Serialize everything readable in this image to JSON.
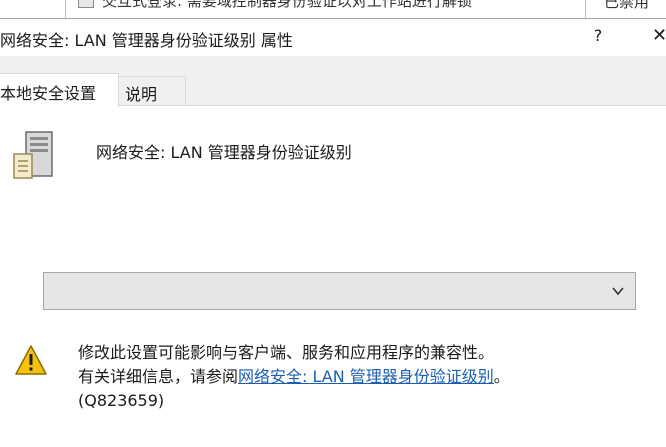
{
  "background_window": {
    "row_text": "交互式登录: 需要域控制器身份验证以对工作站进行解锁",
    "row_status": "已禁用"
  },
  "dialog": {
    "title": "网络安全: LAN 管理器身份验证级别 属性",
    "help_label": "?",
    "close_label": "✕"
  },
  "tabs": [
    {
      "label": "本地安全设置",
      "active": true
    },
    {
      "label": "说明",
      "active": false
    }
  ],
  "policy": {
    "icon": "server-policy-icon",
    "name": "网络安全: LAN 管理器身份验证级别"
  },
  "setting_dropdown": {
    "selected_value": "",
    "icon": "chevron-down-icon"
  },
  "warning": {
    "icon": "warning-triangle-icon",
    "line1": "修改此设置可能影响与客户端、服务和应用程序的兼容性。",
    "line2_prefix": "有关详细信息，请参阅",
    "line2_link": "网络安全: LAN 管理器身份验证级别",
    "line2_suffix": "。",
    "line3": "(Q823659)"
  },
  "colors": {
    "link": "#1a5fb4",
    "tabstrip_bg": "#f0f0f0",
    "dropdown_bg": "#e6e6e6",
    "warning_yellow": "#f5c211"
  }
}
